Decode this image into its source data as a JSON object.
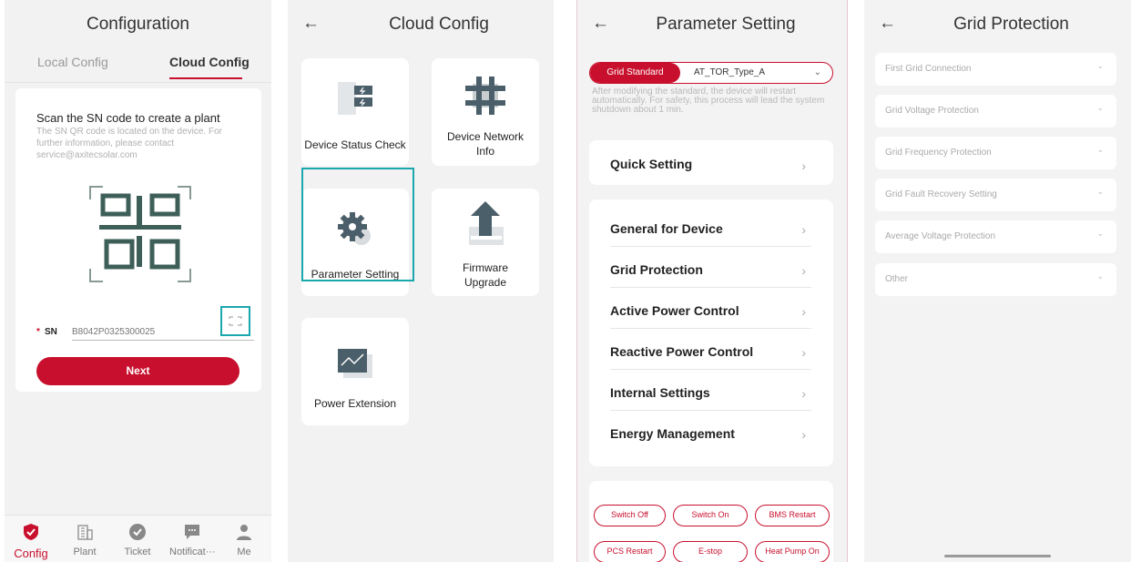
{
  "panel1": {
    "title": "Configuration",
    "tabs": [
      {
        "label": "Local Config"
      },
      {
        "label": "Cloud Config"
      }
    ],
    "scan_title": "Scan the SN code to create a plant",
    "scan_desc": "The SN QR code is located on the device. For further information, please contact service@axitecsolar.com",
    "sn_required": "*",
    "sn_label": "SN",
    "sn_placeholder": "B8042P0325300025",
    "next_label": "Next",
    "nav": [
      {
        "label": "Config",
        "icon": "shield-check-icon",
        "active": true
      },
      {
        "label": "Plant",
        "icon": "building-icon"
      },
      {
        "label": "Ticket",
        "icon": "check-circle-icon"
      },
      {
        "label": "Notificat···",
        "icon": "chat-icon"
      },
      {
        "label": "Me",
        "icon": "person-icon"
      }
    ]
  },
  "panel2": {
    "title": "Cloud Config",
    "back": "←",
    "tiles": [
      {
        "label": "Device Status Check",
        "icon": "device-status-icon"
      },
      {
        "label": "Device Network Info",
        "icon": "network-icon"
      },
      {
        "label": "Parameter Setting",
        "icon": "gear-icon"
      },
      {
        "label": "Firmware Upgrade",
        "icon": "upload-icon"
      },
      {
        "label": "Power Extension",
        "icon": "chart-monitor-icon"
      }
    ]
  },
  "panel3": {
    "title": "Parameter Setting",
    "back": "←",
    "grid_standard_label": "Grid Standard",
    "grid_standard_value": "AT_TOR_Type_A",
    "notice": "After modifying the standard, the device will restart automatically. For safety, this process will lead the system shutdown about 1 min.",
    "quick_setting": "Quick Setting",
    "menu": [
      {
        "label": "General for Device"
      },
      {
        "label": "Grid Protection"
      },
      {
        "label": "Active Power Control"
      },
      {
        "label": "Reactive Power Control"
      },
      {
        "label": "Internal Settings"
      },
      {
        "label": "Energy Management"
      }
    ],
    "actions": [
      {
        "label": "Switch Off"
      },
      {
        "label": "Switch On"
      },
      {
        "label": "BMS Restart"
      },
      {
        "label": "PCS Restart"
      },
      {
        "label": "E-stop"
      },
      {
        "label": "Heat Pump On"
      }
    ]
  },
  "panel4": {
    "title": "Grid Protection",
    "back": "←",
    "items": [
      {
        "label": "First Grid Connection"
      },
      {
        "label": "Grid Voltage Protection"
      },
      {
        "label": "Grid Frequency Protection"
      },
      {
        "label": "Grid Fault Recovery Setting"
      },
      {
        "label": "Average Voltage Protection"
      },
      {
        "label": "Other"
      }
    ]
  },
  "colors": {
    "accent": "#c8102e",
    "highlight": "#1aa7ad",
    "background": "#f2f2f2"
  }
}
